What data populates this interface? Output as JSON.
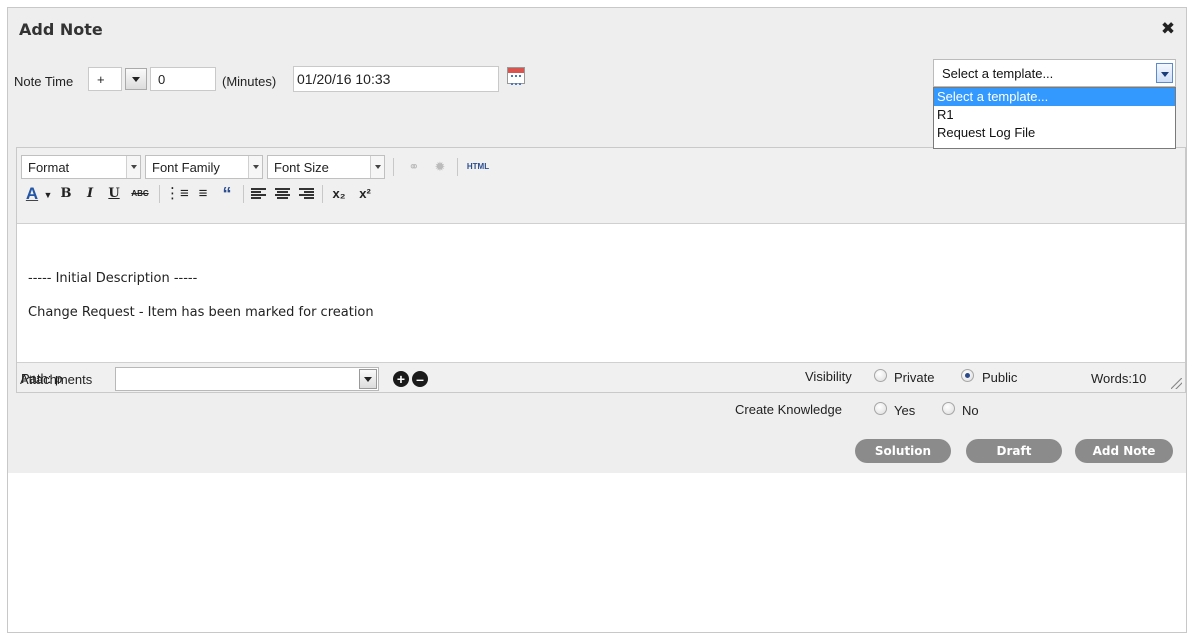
{
  "dialog": {
    "title": "Add Note",
    "close_icon": "close-icon"
  },
  "note_time": {
    "label": "Note Time",
    "sign": "+",
    "offset_value": "0",
    "unit_label": "(Minutes)",
    "datetime": "01/20/16 10:33"
  },
  "template": {
    "selected": "Select a template...",
    "options": [
      "Select a template...",
      "R1",
      "Request Log File"
    ]
  },
  "editor": {
    "format_select": "Format",
    "font_family_select": "Font Family",
    "font_size_select": "Font Size",
    "html_button": "HTML",
    "bold": "B",
    "italic": "I",
    "underline": "U",
    "strike": "ABC",
    "blockquote": "“",
    "subscript": "x₂",
    "superscript": "x²",
    "font_color": "A",
    "lines": [
      "----- Initial Description -----",
      "Change Request - Item has been marked for creation"
    ],
    "path": "Path: p",
    "words": "Words:10"
  },
  "attachments": {
    "label": "Attachments",
    "value": ""
  },
  "visibility": {
    "label": "Visibility",
    "options": [
      "Private",
      "Public"
    ],
    "selected": "Public"
  },
  "knowledge": {
    "label": "Create Knowledge",
    "options": [
      "Yes",
      "No"
    ],
    "selected": ""
  },
  "buttons": {
    "solution": "Solution",
    "draft": "Draft",
    "add_note": "Add Note"
  }
}
